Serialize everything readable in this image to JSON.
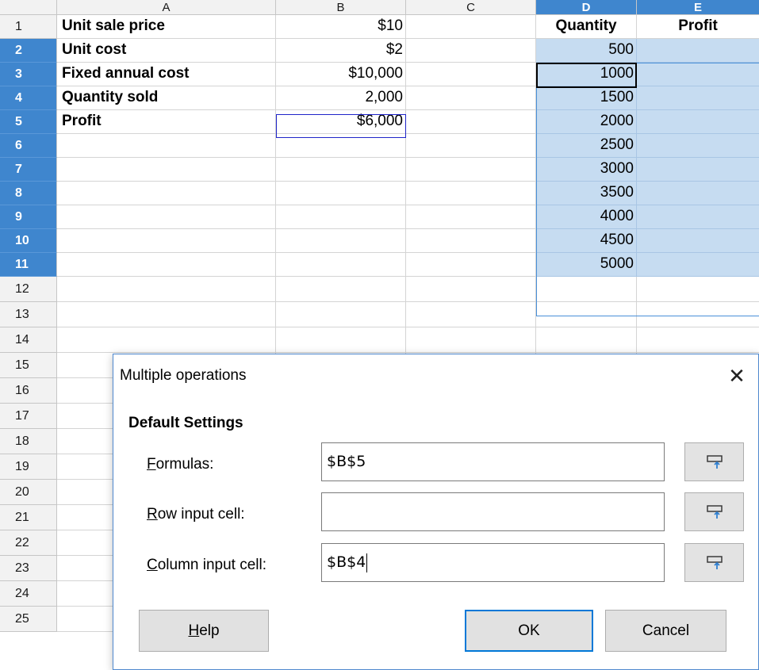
{
  "sheet": {
    "columns": [
      "A",
      "B",
      "C",
      "D",
      "E"
    ],
    "rows": [
      "1",
      "2",
      "3",
      "4",
      "5",
      "6",
      "7",
      "8",
      "9",
      "10",
      "11",
      "12",
      "13",
      "14",
      "15",
      "16",
      "17",
      "18",
      "19",
      "20",
      "21",
      "22",
      "23",
      "24",
      "25"
    ],
    "cells": [
      {
        "label": "Unit sale price",
        "value": "$10"
      },
      {
        "label": "Unit cost",
        "value": "$2"
      },
      {
        "label": "Fixed annual cost",
        "value": "$10,000"
      },
      {
        "label": "Quantity sold",
        "value": "2,000"
      },
      {
        "label": "Profit",
        "value": "$6,000"
      }
    ],
    "d_header": "Quantity",
    "e_header": "Profit",
    "quantities": [
      "500",
      "1000",
      "1500",
      "2000",
      "2500",
      "3000",
      "3500",
      "4000",
      "4500",
      "5000"
    ],
    "selected_columns": [
      "D",
      "E"
    ],
    "selected_rows": [
      "2",
      "3",
      "4",
      "5",
      "6",
      "7",
      "8",
      "9",
      "10",
      "11"
    ],
    "colors": {
      "header_selected": "#3f86ce",
      "range_fill": "#c6dcf1",
      "reference_border": "#1f24c8"
    }
  },
  "dialog": {
    "title": "Multiple operations",
    "close_icon": "close-icon",
    "section": "Default Settings",
    "formulas": {
      "label_u": "F",
      "label_rest": "ormulas:",
      "value": "$B$5"
    },
    "row_input": {
      "label_u": "R",
      "label_rest": "ow input cell:",
      "value": ""
    },
    "column_input": {
      "label_u": "C",
      "label_rest": "olumn input cell:",
      "value": "$B$4"
    },
    "shrink_icon": "shrink-icon",
    "buttons": {
      "help_u": "H",
      "help_rest": "elp",
      "ok": "OK",
      "cancel": "Cancel"
    }
  }
}
